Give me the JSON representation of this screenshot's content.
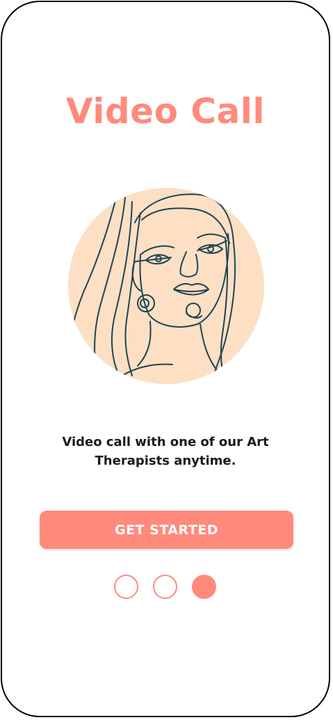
{
  "screen": {
    "title": "Video Call",
    "illustration_icon": "line-art-woman-portrait",
    "description": "Video call with one of our Art Therapists anytime.",
    "cta_label": "GET STARTED"
  },
  "pager": {
    "total": 3,
    "current_page": 3
  },
  "colors": {
    "accent": "#FF8A7C",
    "illustration_bg": "#FDDFC4",
    "line_art": "#1B4353",
    "text": "#1A1A1A"
  }
}
